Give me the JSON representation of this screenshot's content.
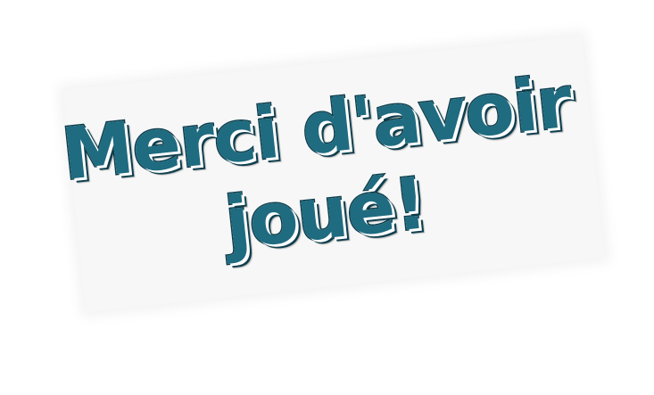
{
  "message": {
    "line1": "Merci d'avoir",
    "line2": "joué!"
  },
  "colors": {
    "text_fill": "#1f6b80",
    "text_outline": "#0d3e4d",
    "card_background": "#f7f7f7",
    "page_background": "#ffffff"
  }
}
